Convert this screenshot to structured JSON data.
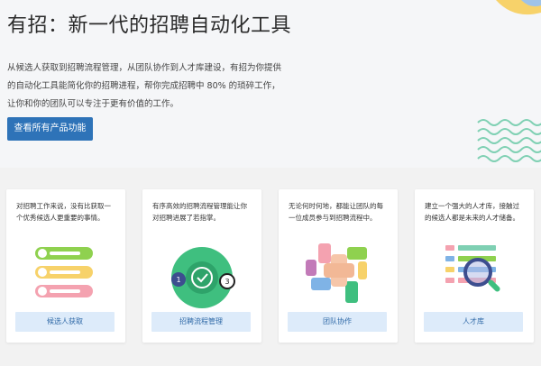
{
  "hero": {
    "title": "有招：新一代的招聘自动化工具",
    "description": "从候选人获取到招聘流程管理，从团队协作到人才库建设，有招为你提供的自动化工具能简化你的招聘进程，帮你完成招聘中 80% 的琐碎工作，让你和你的团队可以专注于更有价值的工作。",
    "cta_label": "查看所有产品功能"
  },
  "cards": [
    {
      "description": "对招聘工作来说，没有比获取一个优秀候选人更重要的事情。",
      "button_label": "候选人获取",
      "icon": "candidate-cards-illustration"
    },
    {
      "description": "有序高效的招聘流程管理能让你对招聘进展了若指掌。",
      "button_label": "招聘流程管理",
      "icon": "process-steps-illustration",
      "step_left": "1",
      "step_right": "3"
    },
    {
      "description": "无论何时何地，都能让团队的每一位成员参与到招聘流程中。",
      "button_label": "团队协作",
      "icon": "team-hands-illustration"
    },
    {
      "description": "建立一个强大的人才库，接触过的候选人都是未来的人才储备。",
      "button_label": "人才库",
      "icon": "talent-search-illustration"
    }
  ],
  "colors": {
    "primary": "#2e73b8",
    "button_bg": "#ddebfa",
    "button_text": "#2f69a7",
    "wave": "#7fd0b3",
    "yellow": "#f7d26a",
    "green": "#3fbf7f",
    "navy": "#3d4e8f"
  }
}
